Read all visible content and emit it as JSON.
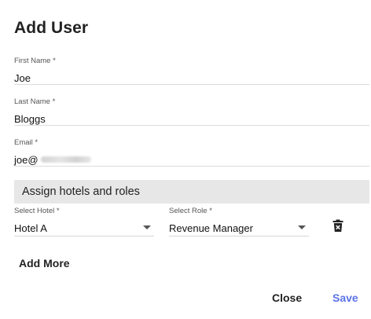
{
  "dialog": {
    "title": "Add User",
    "fields": {
      "first_name": {
        "label": "First Name *",
        "value": "Joe"
      },
      "last_name": {
        "label": "Last Name *",
        "value": "Bloggs"
      },
      "email": {
        "label": "Email *",
        "value": "joe@"
      }
    },
    "section_title": "Assign hotels and roles",
    "hotel_select": {
      "label": "Select Hotel *",
      "value": "Hotel A"
    },
    "role_select": {
      "label": "Select Role *",
      "value": "Revenue Manager"
    },
    "icons": {
      "delete": "trash-icon",
      "dropdown": "chevron-down-icon"
    },
    "buttons": {
      "add_more": "Add More",
      "close": "Close",
      "save": "Save"
    },
    "colors": {
      "accent": "#5b73e8",
      "section_bg": "#e7e7e7"
    }
  }
}
